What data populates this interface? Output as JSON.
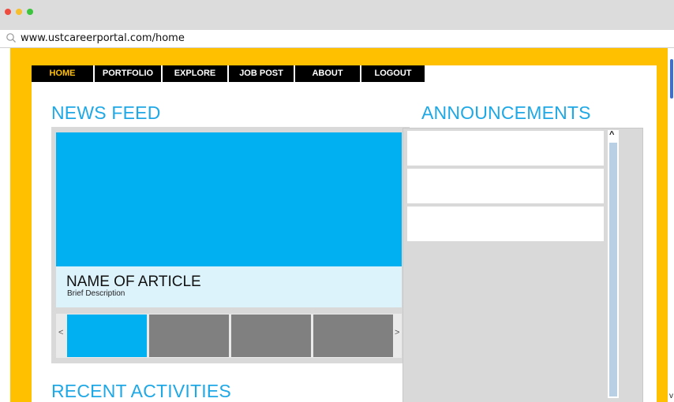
{
  "browser": {
    "url": "www.ustcareerportal.com/home"
  },
  "colors": {
    "frame": "#ffc000",
    "accent": "#1ea8e6",
    "hero": "#00b0f0",
    "thumb_active": "#00b0f0",
    "thumb_inactive": "#808080",
    "nav_active": "#ffc000"
  },
  "nav": {
    "items": [
      {
        "label": "HOME",
        "active": true
      },
      {
        "label": "PORTFOLIO",
        "active": false
      },
      {
        "label": "EXPLORE",
        "active": false
      },
      {
        "label": "JOB POST",
        "active": false
      },
      {
        "label": "ABOUT",
        "active": false
      },
      {
        "label": "LOGOUT",
        "active": false
      }
    ]
  },
  "news_feed": {
    "heading": "NEWS FEED",
    "article": {
      "title": "NAME OF ARTICLE",
      "description": "Brief Description"
    },
    "carousel": {
      "prev": "<",
      "next": ">",
      "active_index": 0,
      "count": 4
    }
  },
  "announcements": {
    "heading": "ANNOUNCEMENTS",
    "scroll_up": "^"
  },
  "recent": {
    "heading": "RECENT ACTIVITIES"
  },
  "window": {
    "scroll_down": "v"
  }
}
